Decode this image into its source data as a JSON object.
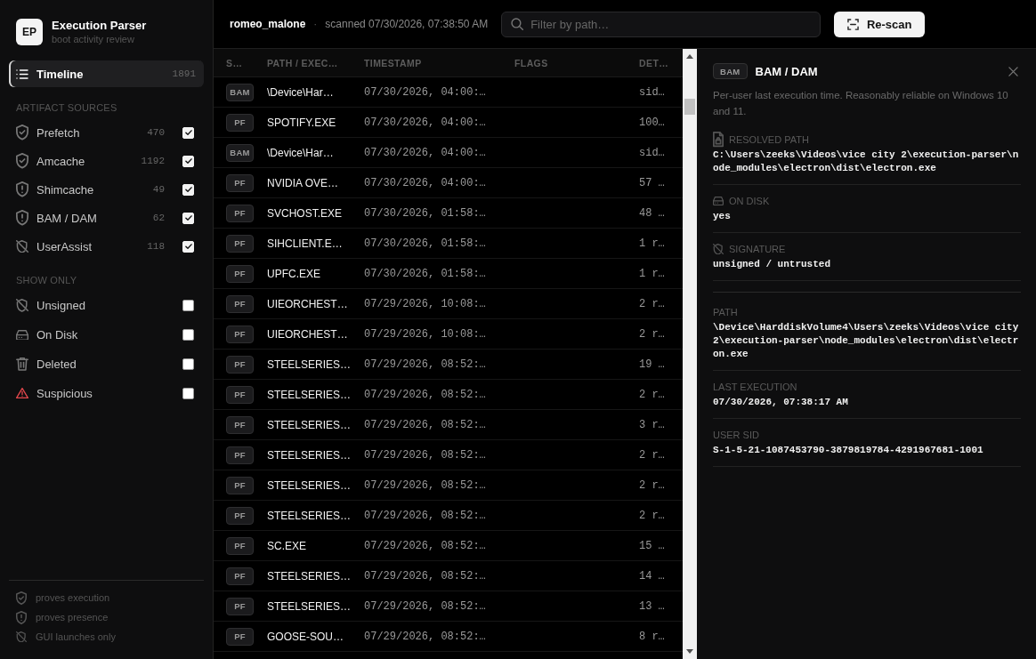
{
  "sidebar": {
    "logo": "EP",
    "title": "Execution Parser",
    "subtitle": "boot activity review",
    "nav": [
      {
        "label": "Timeline",
        "count": "1891",
        "selected": true
      }
    ],
    "sources_heading": "ARTIFACT SOURCES",
    "sources": [
      {
        "label": "Prefetch",
        "count": "470",
        "checked": true,
        "kind": "execution"
      },
      {
        "label": "Amcache",
        "count": "1192",
        "checked": true,
        "kind": "execution"
      },
      {
        "label": "Shimcache",
        "count": "49",
        "checked": true,
        "kind": "presence"
      },
      {
        "label": "BAM / DAM",
        "count": "62",
        "checked": true,
        "kind": "presence"
      },
      {
        "label": "UserAssist",
        "count": "118",
        "checked": true,
        "kind": "gui"
      }
    ],
    "filters_heading": "SHOW ONLY",
    "filters": [
      {
        "label": "Unsigned",
        "checked": false,
        "kind": "unsigned"
      },
      {
        "label": "On Disk",
        "checked": false,
        "kind": "disk"
      },
      {
        "label": "Deleted",
        "checked": false,
        "kind": "deleted"
      },
      {
        "label": "Suspicious",
        "checked": false,
        "kind": "suspicious"
      }
    ],
    "legend": [
      {
        "label": "proves execution",
        "kind": "execution"
      },
      {
        "label": "proves presence",
        "kind": "presence"
      },
      {
        "label": "GUI launches only",
        "kind": "gui"
      }
    ]
  },
  "header": {
    "user": "romeo_malone",
    "separator": "·",
    "scanned": "scanned 07/30/2026, 07:38:50 AM",
    "search": {
      "placeholder": "Filter by path…"
    },
    "button": "Re-scan"
  },
  "table": {
    "columns": [
      "S…",
      "PATH / EXEC…",
      "TIMESTAMP",
      "FLAGS",
      "DET…"
    ],
    "rows": [
      {
        "source": "BAM",
        "path": "\\Device\\Har…",
        "timestamp": "07/30/2026, 04:00:…",
        "details": "sid…"
      },
      {
        "source": "PF",
        "path": "SPOTIFY.EXE",
        "timestamp": "07/30/2026, 04:00:…",
        "details": "100…"
      },
      {
        "source": "BAM",
        "path": "\\Device\\Har…",
        "timestamp": "07/30/2026, 04:00:…",
        "details": "sid…"
      },
      {
        "source": "PF",
        "path": "NVIDIA OVE…",
        "timestamp": "07/30/2026, 04:00:…",
        "details": "57 …"
      },
      {
        "source": "PF",
        "path": "SVCHOST.EXE",
        "timestamp": "07/30/2026, 01:58:…",
        "details": "48 …"
      },
      {
        "source": "PF",
        "path": "SIHCLIENT.E…",
        "timestamp": "07/30/2026, 01:58:…",
        "details": "1 r…"
      },
      {
        "source": "PF",
        "path": "UPFC.EXE",
        "timestamp": "07/30/2026, 01:58:…",
        "details": "1 r…"
      },
      {
        "source": "PF",
        "path": "UIEORCHEST…",
        "timestamp": "07/29/2026, 10:08:…",
        "details": "2 r…"
      },
      {
        "source": "PF",
        "path": "UIEORCHEST…",
        "timestamp": "07/29/2026, 10:08:…",
        "details": "2 r…"
      },
      {
        "source": "PF",
        "path": "STEELSERIES…",
        "timestamp": "07/29/2026, 08:52:…",
        "details": "19 …"
      },
      {
        "source": "PF",
        "path": "STEELSERIES…",
        "timestamp": "07/29/2026, 08:52:…",
        "details": "2 r…"
      },
      {
        "source": "PF",
        "path": "STEELSERIES…",
        "timestamp": "07/29/2026, 08:52:…",
        "details": "3 r…"
      },
      {
        "source": "PF",
        "path": "STEELSERIES…",
        "timestamp": "07/29/2026, 08:52:…",
        "details": "2 r…"
      },
      {
        "source": "PF",
        "path": "STEELSERIES…",
        "timestamp": "07/29/2026, 08:52:…",
        "details": "2 r…"
      },
      {
        "source": "PF",
        "path": "STEELSERIES…",
        "timestamp": "07/29/2026, 08:52:…",
        "details": "2 r…"
      },
      {
        "source": "PF",
        "path": "SC.EXE",
        "timestamp": "07/29/2026, 08:52:…",
        "details": "15 …"
      },
      {
        "source": "PF",
        "path": "STEELSERIES…",
        "timestamp": "07/29/2026, 08:52:…",
        "details": "14 …"
      },
      {
        "source": "PF",
        "path": "STEELSERIES…",
        "timestamp": "07/29/2026, 08:52:…",
        "details": "13 …"
      },
      {
        "source": "PF",
        "path": "GOOSE-SOU…",
        "timestamp": "07/29/2026, 08:52:…",
        "details": "8 r…"
      }
    ]
  },
  "detail": {
    "badge": "BAM",
    "title": "BAM / DAM",
    "description": "Per-user last execution time. Reasonably reliable on Windows 10 and 11.",
    "sections": [
      {
        "fields": [
          {
            "label": "RESOLVED PATH",
            "kind": "file",
            "value": "C:\\Users\\zeeks\\Videos\\vice city 2\\execution-parser\\node_modules\\electron\\dist\\electron.exe"
          },
          {
            "label": "ON DISK",
            "kind": "disk",
            "value": "yes"
          },
          {
            "label": "SIGNATURE",
            "kind": "unsigned",
            "value": "unsigned / untrusted"
          }
        ]
      },
      {
        "fields": [
          {
            "label": "PATH",
            "kind": "plain",
            "value": "\\Device\\HarddiskVolume4\\Users\\zeeks\\Videos\\vice city 2\\execution-parser\\node_modules\\electron\\dist\\electron.exe"
          },
          {
            "label": "LAST EXECUTION",
            "kind": "plain",
            "value": "07/30/2026, 07:38:17 AM"
          },
          {
            "label": "USER SID",
            "kind": "plain",
            "value": "S-1-5-21-1087453790-3879819784-4291967681-1001"
          }
        ]
      }
    ]
  }
}
